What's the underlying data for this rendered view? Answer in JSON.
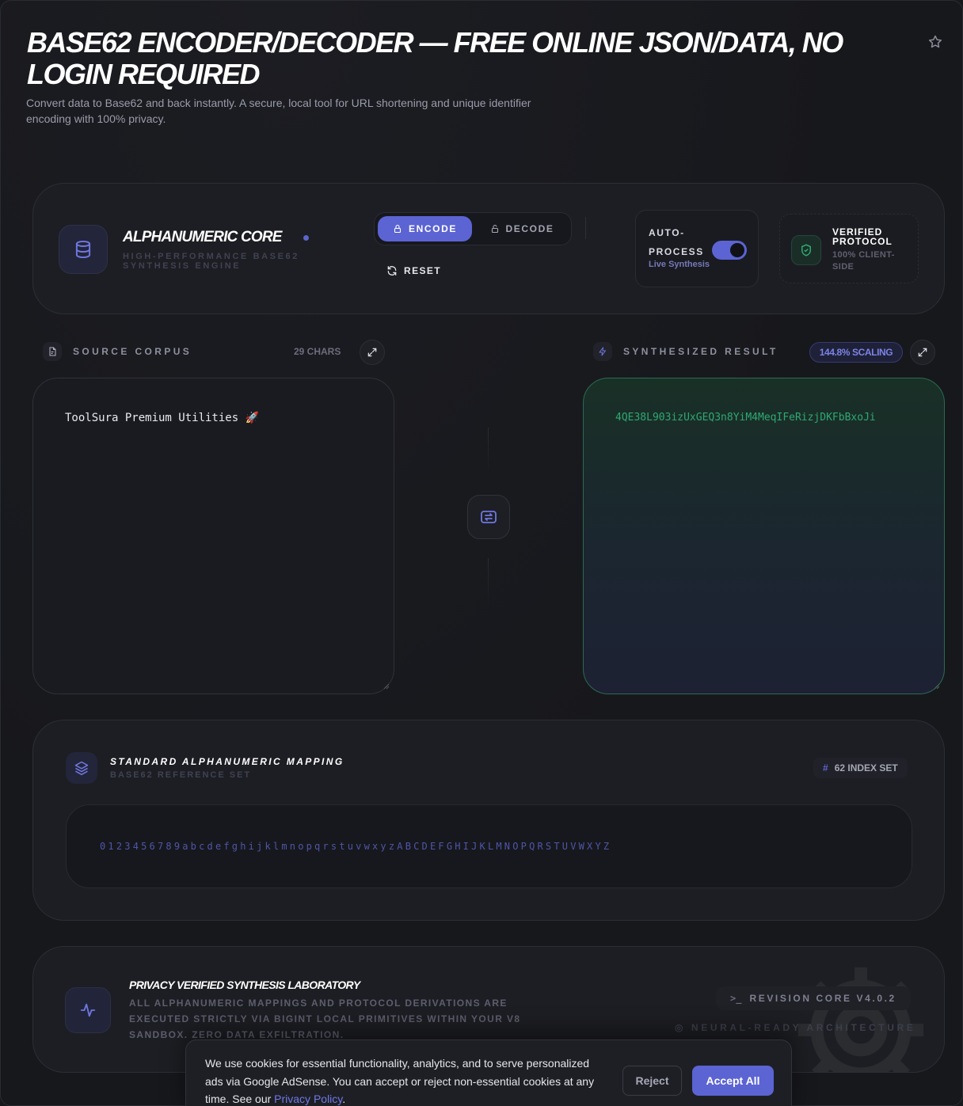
{
  "header": {
    "title": "BASE62 ENCODER/DECODER — FREE ONLINE JSON/DATA, NO LOGIN REQUIRED",
    "subtitle": "Convert data to Base62 and back instantly. A secure, local tool for URL shortening and unique identifier encoding with 100% privacy."
  },
  "control_panel": {
    "brand_title": "ALPHANUMERIC CORE",
    "brand_subtitle": "HIGH-PERFORMANCE BASE62 SYNTHESIS ENGINE",
    "encode_label": "ENCODE",
    "decode_label": "DECODE",
    "active_mode": "ENCODE",
    "reset_label": "RESET",
    "auto_process_label": "AUTO-PROCESS",
    "auto_process_sub": "Live Synthesis",
    "auto_process_on": true,
    "verified_title": "VERIFIED PROTOCOL",
    "verified_sub": "100% CLIENT-SIDE"
  },
  "source": {
    "label": "SOURCE CORPUS",
    "char_count": "29 CHARS",
    "value": "ToolSura Premium Utilities 🚀"
  },
  "result": {
    "label": "SYNTHESIZED RESULT",
    "scaling": "144.8% SCALING",
    "value": "4QE38L903izUxGEQ3n8YiM4MeqIFeRizjDKFbBxoJi"
  },
  "mapping": {
    "title": "STANDARD ALPHANUMERIC MAPPING",
    "subtitle": "BASE62 REFERENCE SET",
    "badge": "62 INDEX SET",
    "alphabet": "0123456789abcdefghijklmnopqrstuvwxyzABCDEFGHIJKLMNOPQRSTUVWXYZ"
  },
  "lab": {
    "title": "PRIVACY VERIFIED SYNTHESIS LABORATORY",
    "text": "ALL ALPHANUMERIC MAPPINGS AND PROTOCOL DERIVATIONS ARE EXECUTED STRICTLY VIA BIGINT LOCAL PRIMITIVES WITHIN YOUR V8 SANDBOX. ZERO DATA EXFILTRATION.",
    "revision": "REVISION CORE V4.0.2",
    "neural": "NEURAL-READY ARCHITECTURE"
  },
  "cookie": {
    "text": "We use cookies for essential functionality, analytics, and to serve personalized ads via Google AdSense. You can accept or reject non-essential cookies at any time. See our ",
    "link": "Privacy Policy",
    "end": ".",
    "reject": "Reject",
    "accept": "Accept All"
  },
  "colors": {
    "accent": "#5b64d2",
    "success": "#2fa874",
    "background": "#17181c"
  },
  "icons": {
    "star": "star-icon",
    "brand": "database-icon",
    "lock": "lock-icon",
    "reset": "refresh-icon",
    "shield": "shield-check-icon",
    "file": "file-icon",
    "bolt": "bolt-icon",
    "expand": "expand-icon",
    "swap": "swap-icon",
    "layers": "layers-icon",
    "activity": "activity-icon",
    "terminal": "terminal-icon"
  }
}
